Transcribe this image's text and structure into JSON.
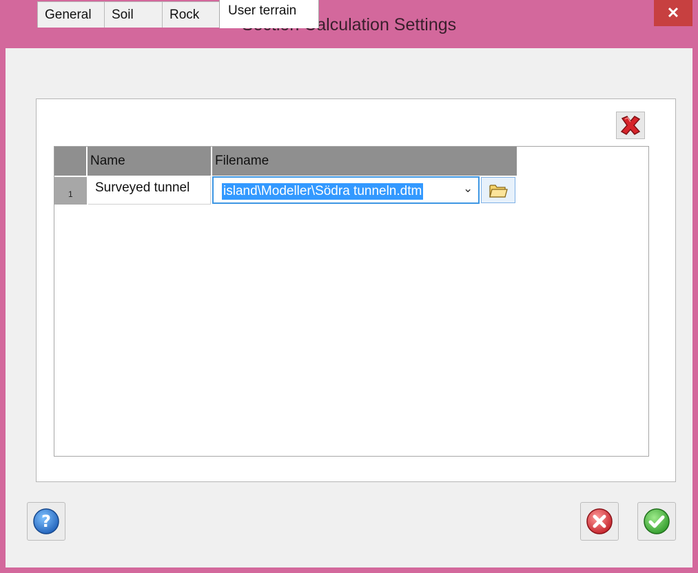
{
  "window": {
    "title": "Section Calculation Settings",
    "close_label": "✕"
  },
  "tabs": [
    {
      "label": "General",
      "active": false
    },
    {
      "label": "Soil",
      "active": false
    },
    {
      "label": "Rock",
      "active": false
    },
    {
      "label": "User terrain",
      "active": true
    }
  ],
  "grid": {
    "columns": [
      "Name",
      "Filename"
    ],
    "rows": [
      {
        "index": "1",
        "name": "Surveyed tunnel",
        "filename": "island\\Modeller\\Södra tunneln.dtm"
      }
    ]
  },
  "icons": {
    "delete": "red-x-icon",
    "browse": "folder-icon",
    "help": "question-icon",
    "cancel": "cancel-icon",
    "ok": "checkmark-icon"
  },
  "colors": {
    "titlebar": "#d3689c",
    "selection": "#3399ff",
    "close": "#c74040"
  }
}
